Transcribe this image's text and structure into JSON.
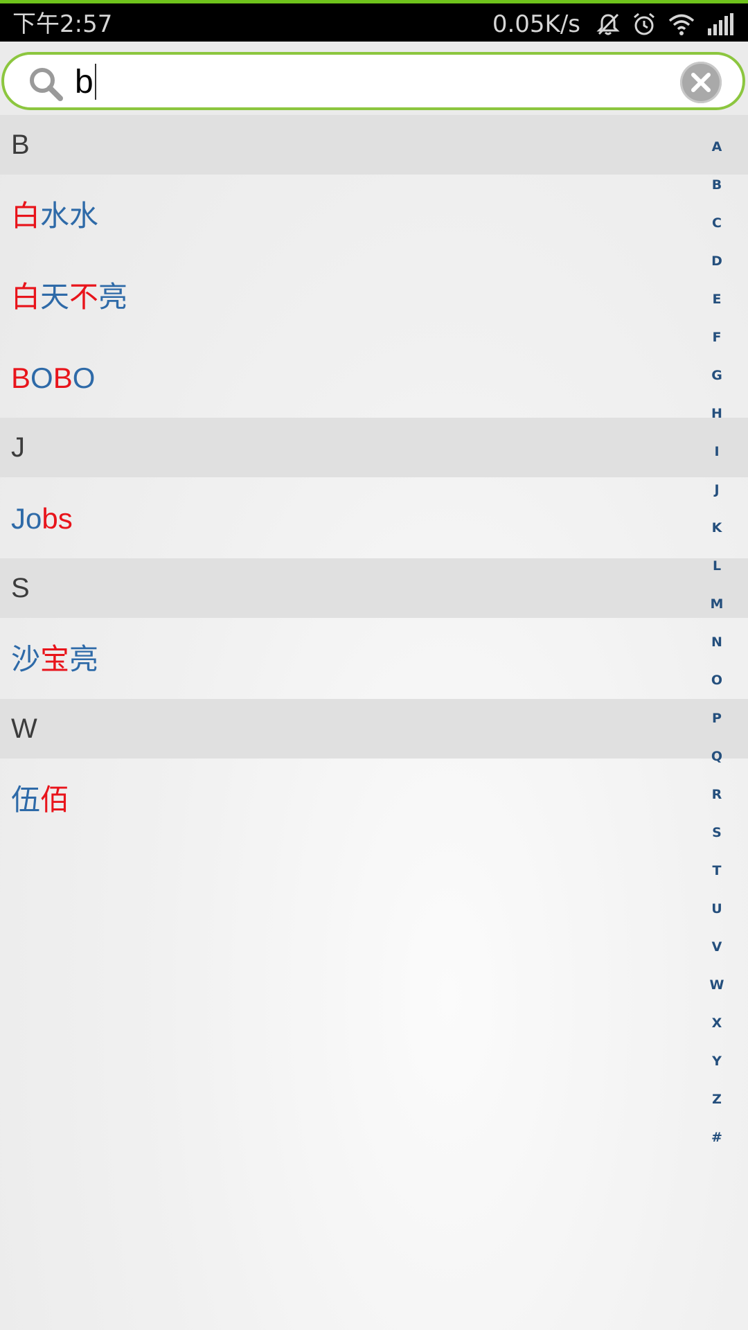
{
  "status_bar": {
    "time": "下午2:57",
    "net_speed": "0.05K/s",
    "icons": [
      "muted-bell-icon",
      "alarm-icon",
      "wifi-icon",
      "signal-icon"
    ]
  },
  "search": {
    "value": "b"
  },
  "colors": {
    "highlight": "#e8141b",
    "name_text": "#2e6aa8",
    "search_border": "#8cc63f",
    "index_text": "#244f7d"
  },
  "list": {
    "sections": [
      {
        "header": "B",
        "contacts": [
          {
            "name": "白水水",
            "chars": [
              "白",
              "水",
              "水"
            ],
            "highlight": [
              true,
              false,
              false
            ]
          },
          {
            "name": "白天不亮",
            "chars": [
              "白",
              "天",
              "不",
              "亮"
            ],
            "highlight": [
              true,
              false,
              true,
              false
            ]
          },
          {
            "name": "BOBO",
            "chars": [
              "B",
              "O",
              "B",
              "O"
            ],
            "highlight": [
              true,
              false,
              true,
              false
            ]
          }
        ]
      },
      {
        "header": "J",
        "contacts": [
          {
            "name": "Jobs",
            "chars": [
              "J",
              "o",
              "b",
              "s"
            ],
            "highlight": [
              false,
              false,
              true,
              true
            ]
          }
        ]
      },
      {
        "header": "S",
        "contacts": [
          {
            "name": "沙宝亮",
            "chars": [
              "沙",
              "宝",
              "亮"
            ],
            "highlight": [
              false,
              true,
              false
            ]
          }
        ]
      },
      {
        "header": "W",
        "contacts": [
          {
            "name": "伍佰",
            "chars": [
              "伍",
              "佰"
            ],
            "highlight": [
              false,
              true
            ]
          }
        ]
      }
    ]
  },
  "index_bar": [
    "A",
    "B",
    "C",
    "D",
    "E",
    "F",
    "G",
    "H",
    "I",
    "J",
    "K",
    "L",
    "M",
    "N",
    "O",
    "P",
    "Q",
    "R",
    "S",
    "T",
    "U",
    "V",
    "W",
    "X",
    "Y",
    "Z",
    "#"
  ]
}
